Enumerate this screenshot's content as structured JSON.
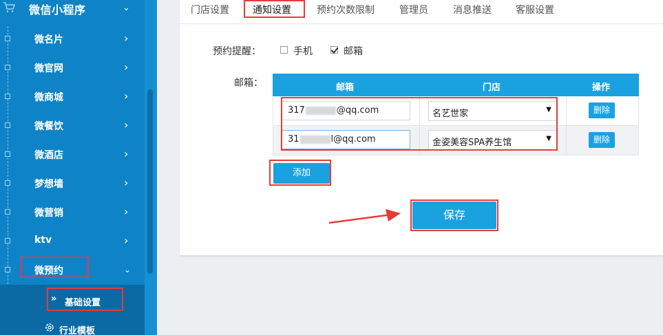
{
  "sidebar": {
    "header": {
      "title": "微信小程序",
      "icon": "shopping-cart-icon"
    },
    "items": [
      {
        "label": "微名片"
      },
      {
        "label": "微官网"
      },
      {
        "label": "微商城"
      },
      {
        "label": "微餐饮"
      },
      {
        "label": "微酒店"
      },
      {
        "label": "梦想墙"
      },
      {
        "label": "微营销"
      },
      {
        "label": "ktv"
      },
      {
        "label": "微预约"
      }
    ],
    "submenu": [
      {
        "label": "基础设置",
        "icon": "double-chevron-icon"
      },
      {
        "label": "行业模板",
        "icon": "gear-icon"
      }
    ]
  },
  "tabs": [
    "门店设置",
    "通知设置",
    "预约次数限制",
    "管理员",
    "消息推送",
    "客服设置"
  ],
  "form": {
    "reminder_label": "预约提醒：",
    "options": [
      {
        "label": "手机",
        "checked": false
      },
      {
        "label": "邮箱",
        "checked": true
      }
    ],
    "email_label": "邮箱："
  },
  "table": {
    "headers": [
      "邮箱",
      "门店",
      "操作"
    ],
    "rows": [
      {
        "email_prefix": "317",
        "email_suffix": "@qq.com",
        "store": "名艺世家",
        "action": "删除"
      },
      {
        "email_prefix": "31",
        "email_suffix": "l@qq.com",
        "store": "金姿美容SPA养生馆",
        "action": "删除"
      }
    ]
  },
  "buttons": {
    "add": "添加",
    "save": "保存"
  },
  "colors": {
    "sidebar": "#0e83c7",
    "accent": "#1aa2e0",
    "annotation": "#e83a3a"
  }
}
